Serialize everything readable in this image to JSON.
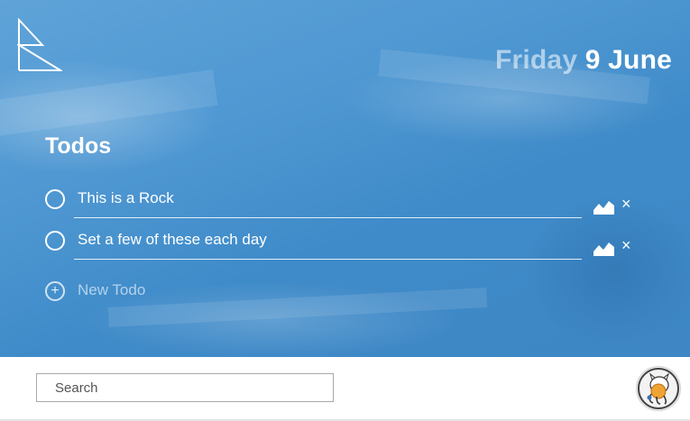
{
  "header": {
    "logo_icon": "r-triangle-logo-icon",
    "date_day": "Friday",
    "date_daymonth": "9 June"
  },
  "todos": {
    "title": "Todos",
    "items": [
      {
        "text": "This is a Rock",
        "done": false,
        "image_icon": "mountain-icon",
        "remove_icon": "close-icon",
        "remove_label": "×"
      },
      {
        "text": "Set a few of these each day",
        "done": false,
        "image_icon": "mountain-icon",
        "remove_icon": "close-icon",
        "remove_label": "×"
      }
    ],
    "new_todo": {
      "icon": "plus-circle-icon",
      "symbol": "+",
      "label": "New Todo"
    }
  },
  "footer": {
    "search_placeholder": "Search",
    "search_value": "",
    "avatar_icon": "octocat-icon"
  },
  "colors": {
    "hero_blue": "#4e97d2",
    "text_white": "#ffffff",
    "date_day_faded": "rgba(255,255,255,0.55)"
  }
}
